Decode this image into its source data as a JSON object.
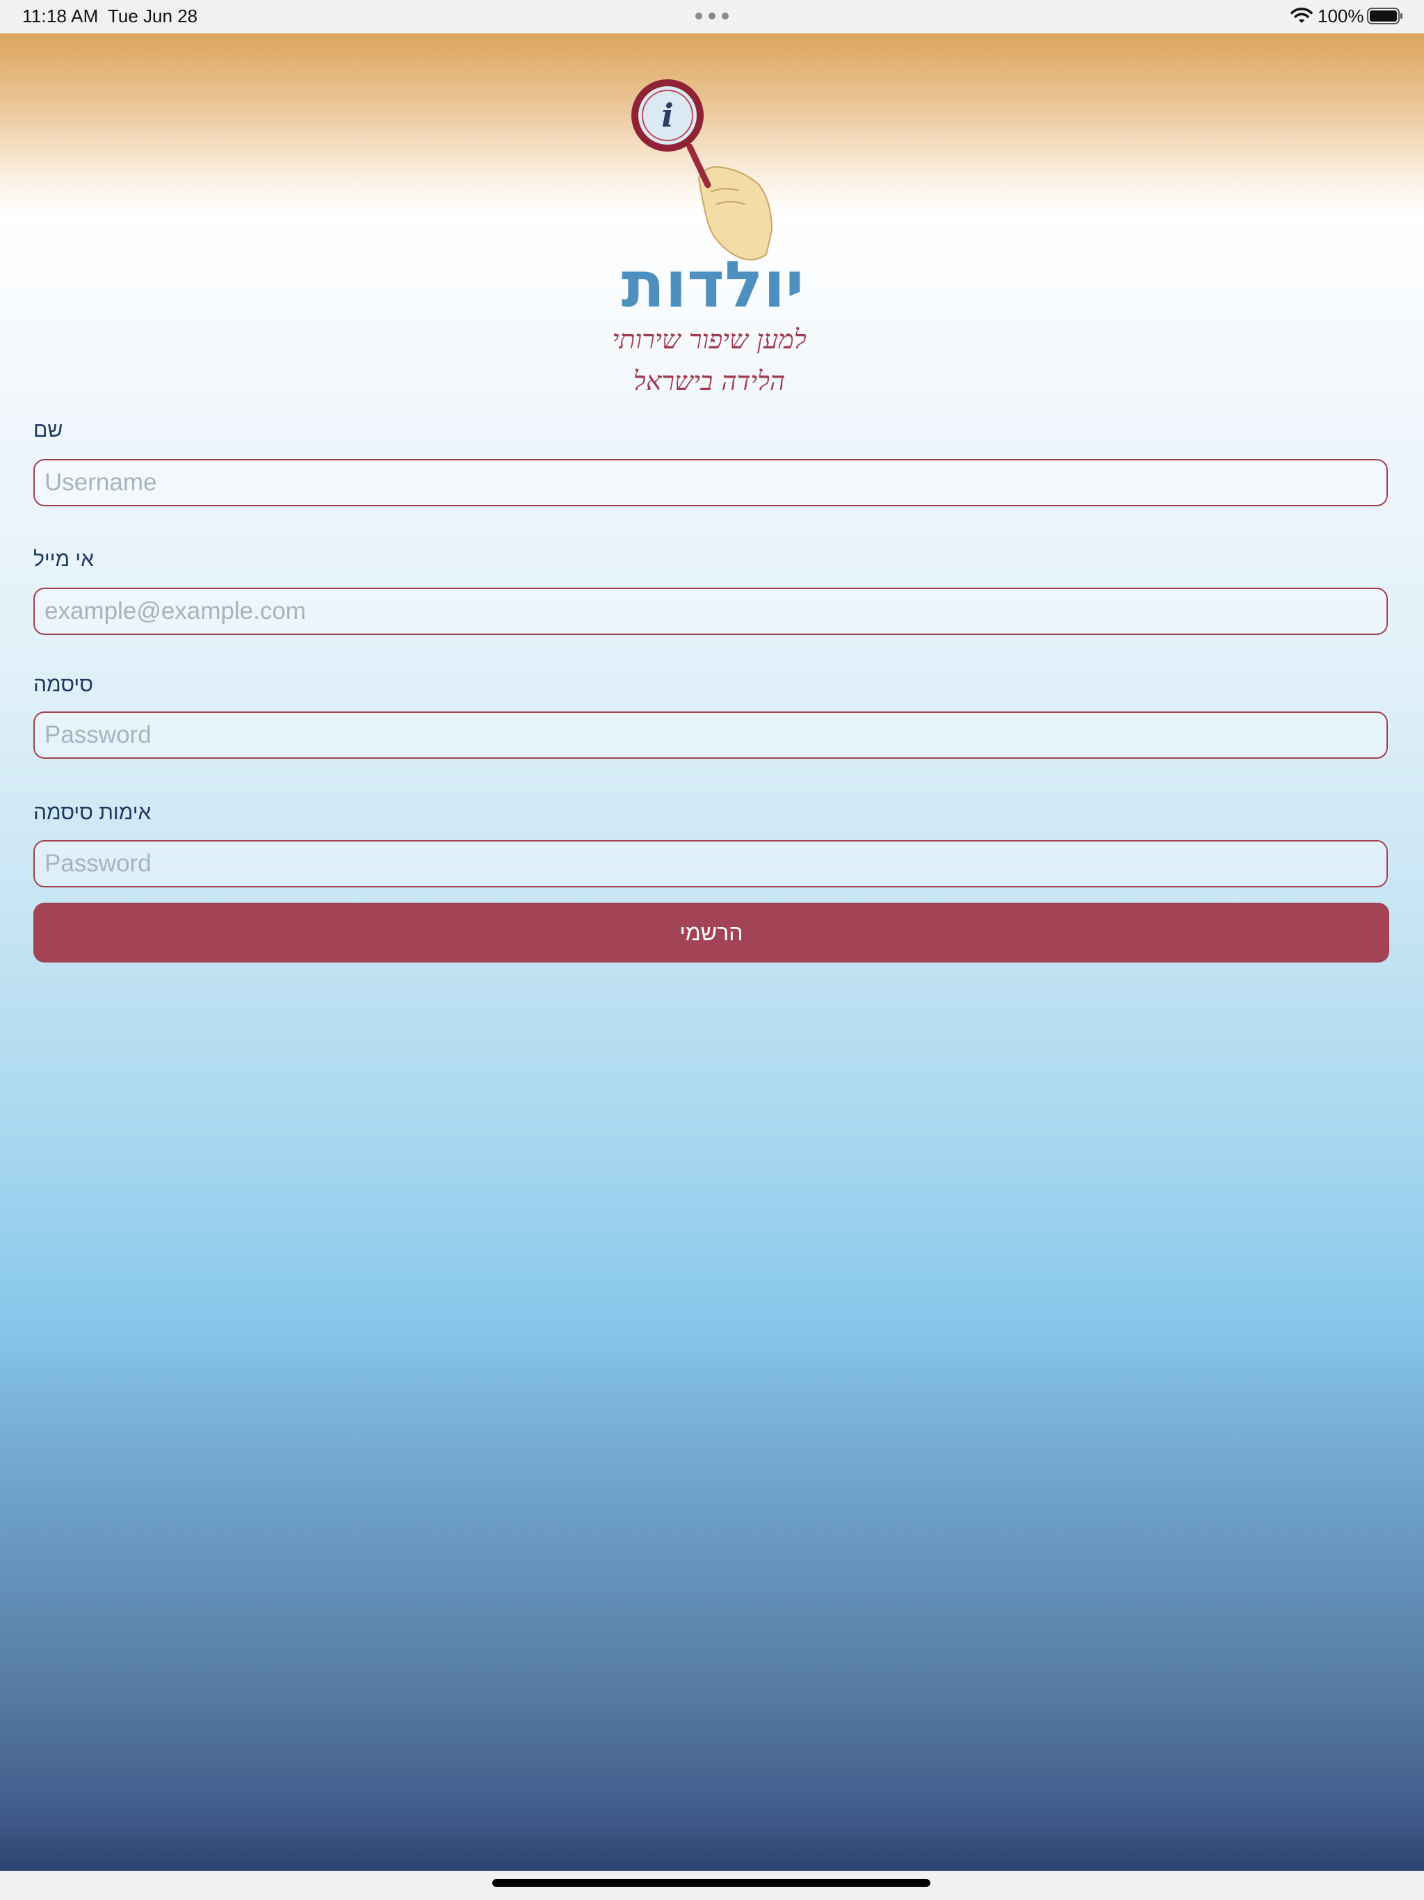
{
  "status_bar": {
    "time": "11:18 AM",
    "date": "Tue Jun 28",
    "battery": "100%"
  },
  "logo": {
    "title": "יולדות",
    "tagline_line1": "למען שיפור שירותי",
    "tagline_line2": "הלידה בישראל",
    "icon_letter": "i"
  },
  "form": {
    "name_label": "שם",
    "name_placeholder": "Username",
    "email_label": "אי מייל",
    "email_placeholder": "example@example.com",
    "password_label": "סיסמה",
    "password_placeholder": "Password",
    "confirm_label": "אימות סיסמה",
    "confirm_placeholder": "Password",
    "register_label": "הרשמי"
  },
  "colors": {
    "accent": "#a24455",
    "label": "#1e3a62",
    "logo_blue": "#4d8fbf"
  }
}
